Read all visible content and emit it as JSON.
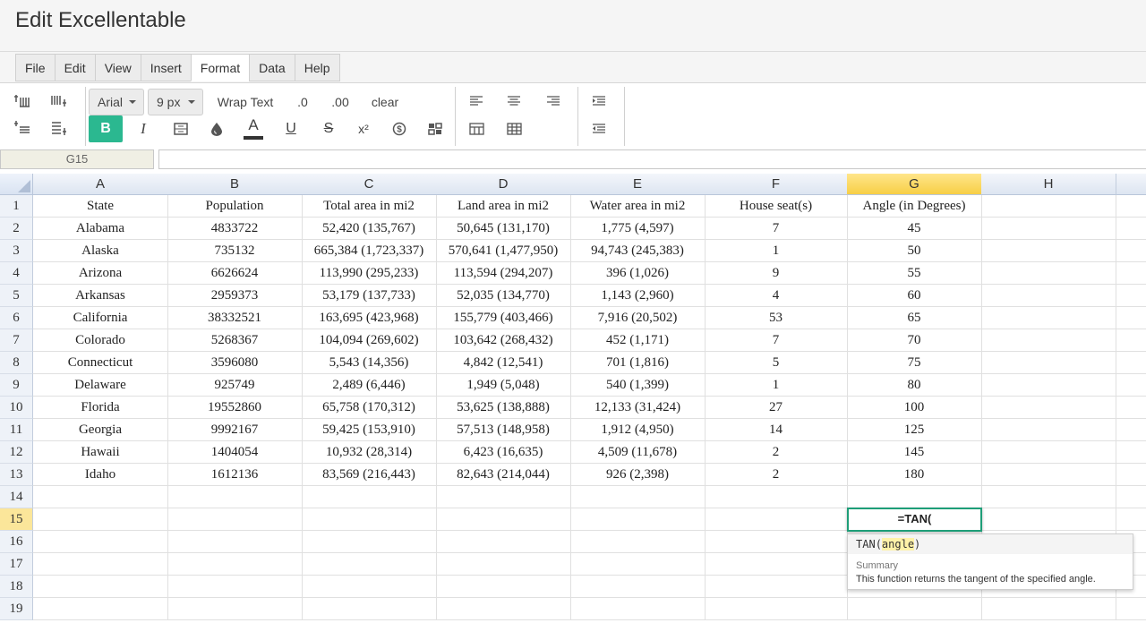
{
  "app": {
    "title": "Edit Excellentable"
  },
  "menu": [
    "File",
    "Edit",
    "View",
    "Insert",
    "Format",
    "Data",
    "Help"
  ],
  "menu_active_index": 4,
  "toolbar": {
    "font_family": "Arial",
    "font_size": "9 px",
    "wrap_text": "Wrap Text",
    "decimal_decrease": ".0",
    "decimal_increase": ".00",
    "clear": "clear",
    "bold": "B",
    "italic": "I",
    "text_color": "A",
    "underline": "U",
    "strike": "S",
    "superscript": "x²",
    "colors": {
      "accent": "#2bb890",
      "active_border": "#1e9e78",
      "selected_header": "#f7cf45"
    }
  },
  "formula_bar": {
    "cell_ref": "G15",
    "value": ""
  },
  "grid": {
    "columns": [
      "A",
      "B",
      "C",
      "D",
      "E",
      "F",
      "G",
      "H"
    ],
    "selected_column": "G",
    "selected_row": 15,
    "row_numbers": [
      1,
      2,
      3,
      4,
      5,
      6,
      7,
      8,
      9,
      10,
      11,
      12,
      13,
      14,
      15,
      16,
      17,
      18,
      19
    ],
    "rows": [
      [
        "State",
        "Population",
        "Total area in mi2",
        "Land area in mi2",
        "Water area in mi2",
        "House seat(s)",
        "Angle (in Degrees)",
        ""
      ],
      [
        "Alabama",
        "4833722",
        "52,420 (135,767)",
        "50,645 (131,170)",
        "1,775 (4,597)",
        "7",
        "45",
        ""
      ],
      [
        "Alaska",
        "735132",
        "665,384 (1,723,337)",
        "570,641 (1,477,950)",
        "94,743 (245,383)",
        "1",
        "50",
        ""
      ],
      [
        "Arizona",
        "6626624",
        "113,990 (295,233)",
        "113,594 (294,207)",
        "396 (1,026)",
        "9",
        "55",
        ""
      ],
      [
        "Arkansas",
        "2959373",
        "53,179 (137,733)",
        "52,035 (134,770)",
        "1,143 (2,960)",
        "4",
        "60",
        ""
      ],
      [
        "California",
        "38332521",
        "163,695 (423,968)",
        "155,779 (403,466)",
        "7,916 (20,502)",
        "53",
        "65",
        ""
      ],
      [
        "Colorado",
        "5268367",
        "104,094 (269,602)",
        "103,642 (268,432)",
        "452 (1,171)",
        "7",
        "70",
        ""
      ],
      [
        "Connecticut",
        "3596080",
        "5,543 (14,356)",
        "4,842 (12,541)",
        "701 (1,816)",
        "5",
        "75",
        ""
      ],
      [
        "Delaware",
        "925749",
        "2,489 (6,446)",
        "1,949 (5,048)",
        "540 (1,399)",
        "1",
        "80",
        ""
      ],
      [
        "Florida",
        "19552860",
        "65,758 (170,312)",
        "53,625 (138,888)",
        "12,133 (31,424)",
        "27",
        "100",
        ""
      ],
      [
        "Georgia",
        "9992167",
        "59,425 (153,910)",
        "57,513 (148,958)",
        "1,912 (4,950)",
        "14",
        "125",
        ""
      ],
      [
        "Hawaii",
        "1404054",
        "10,932 (28,314)",
        "6,423 (16,635)",
        "4,509 (11,678)",
        "2",
        "145",
        ""
      ],
      [
        "Idaho",
        "1612136",
        "83,569 (216,443)",
        "82,643 (214,044)",
        "926 (2,398)",
        "2",
        "180",
        ""
      ],
      [
        "",
        "",
        "",
        "",
        "",
        "",
        "",
        ""
      ],
      [
        "",
        "",
        "",
        "",
        "",
        "",
        "",
        ""
      ],
      [
        "",
        "",
        "",
        "",
        "",
        "",
        "",
        ""
      ],
      [
        "",
        "",
        "",
        "",
        "",
        "",
        "",
        ""
      ],
      [
        "",
        "",
        "",
        "",
        "",
        "",
        "",
        ""
      ],
      [
        "",
        "",
        "",
        "",
        "",
        "",
        "",
        ""
      ]
    ]
  },
  "editing_cell": {
    "value": "=TAN("
  },
  "autocomplete": {
    "function_name": "TAN",
    "open_paren": "(",
    "argument": "angle",
    "close_paren": ")",
    "summary_label": "Summary",
    "summary_text": "This function returns the tangent of the specified angle."
  }
}
